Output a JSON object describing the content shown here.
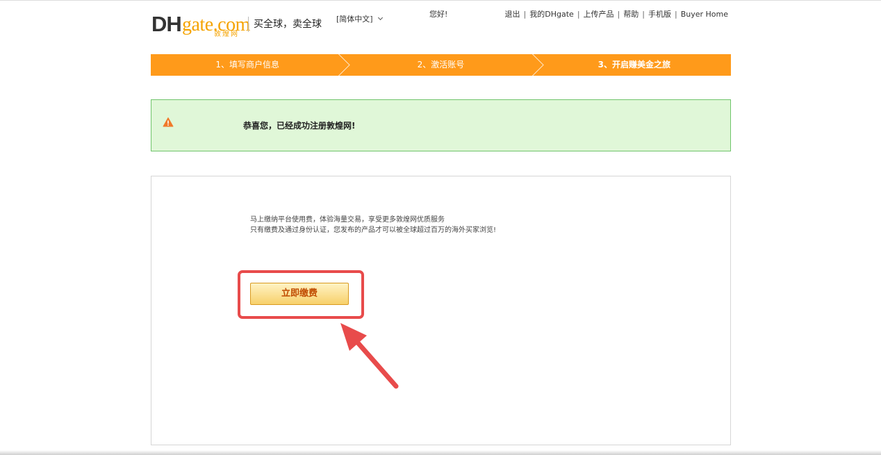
{
  "header": {
    "logo_dh": "DH",
    "logo_gate": "gate.com",
    "logo_cn": "敦煌网",
    "slogan": "买全球，卖全球",
    "language": "[简体中文]",
    "greeting": "您好!",
    "links": [
      {
        "label": "退出"
      },
      {
        "label": "我的DHgate"
      },
      {
        "label": "上传产品"
      },
      {
        "label": "帮助"
      },
      {
        "label": "手机版"
      },
      {
        "label": "Buyer Home"
      }
    ]
  },
  "steps": [
    {
      "label": "1、填写商户信息",
      "active": false
    },
    {
      "label": "2、激活账号",
      "active": false
    },
    {
      "label": "3、开启赚美金之旅",
      "active": true
    }
  ],
  "notice": {
    "icon": "warning-icon",
    "text": "恭喜您，已经成功注册敦煌网!"
  },
  "content": {
    "line1": "马上缴纳平台使用费，体验海量交易，享受更多敦煌网优质服务",
    "line2": "只有缴费及通过身份认证，您发布的产品才可以被全球超过百万的海外买家浏览!",
    "pay_button": "立即缴费"
  },
  "colors": {
    "step_bar": "#ff9a1a",
    "notice_bg": "#e0f7d8",
    "notice_border": "#6fc46b",
    "annotation_red": "#e84b4b",
    "logo_orange": "#f5a300"
  }
}
